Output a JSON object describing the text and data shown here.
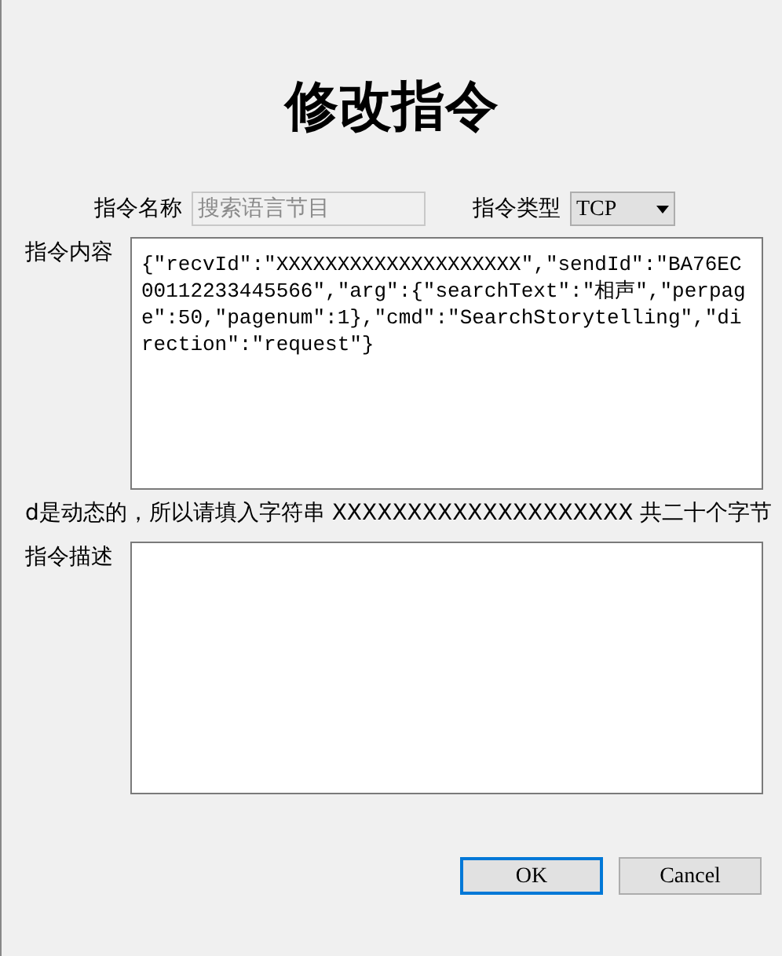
{
  "title": "修改指令",
  "name_field": {
    "label": "指令名称",
    "value": "搜索语言节目",
    "disabled": true
  },
  "type_field": {
    "label": "指令类型",
    "value": "TCP"
  },
  "content_field": {
    "label": "指令内容",
    "value": "{\"recvId\":\"XXXXXXXXXXXXXXXXXXXX\",\"sendId\":\"BA76EC00112233445566\",\"arg\":{\"searchText\":\"相声\",\"perpage\":50,\"pagenum\":1},\"cmd\":\"SearchStorytelling\",\"direction\":\"request\"}"
  },
  "note": "d是动态的，所以请填入字符串 XXXXXXXXXXXXXXXXXXXX 共二十个字节",
  "description_field": {
    "label": "指令描述"
  },
  "buttons": [
    {
      "label": "OK",
      "selected": true
    },
    {
      "label": "Cancel",
      "selected": false
    }
  ]
}
